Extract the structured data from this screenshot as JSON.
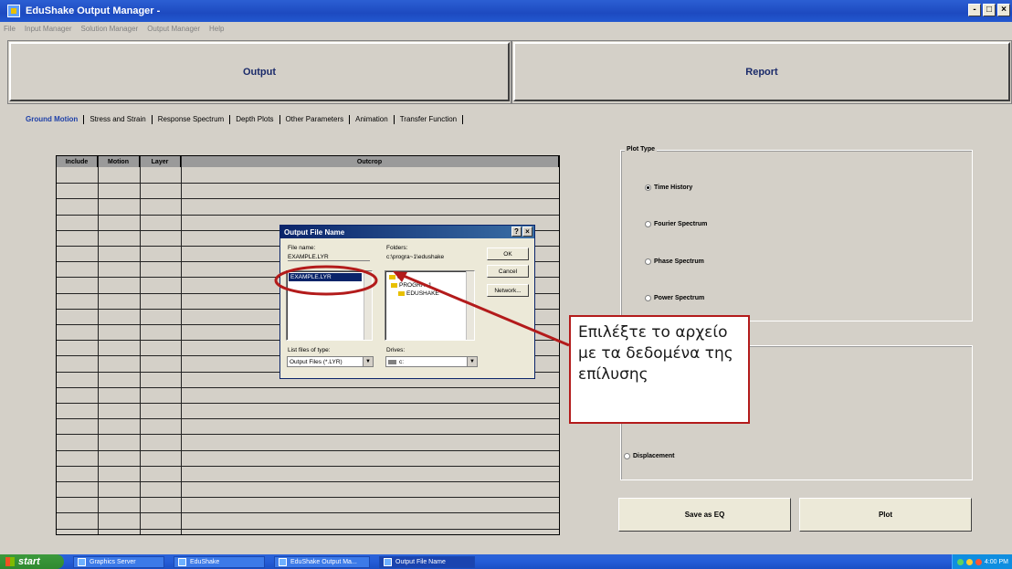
{
  "window": {
    "title": "EduShake Output Manager -"
  },
  "menu": [
    "File",
    "Input Manager",
    "Solution Manager",
    "Output Manager",
    "Help"
  ],
  "big_buttons": {
    "output": "Output",
    "report": "Report"
  },
  "tabs": [
    {
      "label": "Ground Motion",
      "active": true
    },
    {
      "label": "Stress and Strain"
    },
    {
      "label": "Response Spectrum"
    },
    {
      "label": "Depth Plots"
    },
    {
      "label": "Other Parameters"
    },
    {
      "label": "Animation"
    },
    {
      "label": "Transfer Function"
    }
  ],
  "grid": {
    "columns": [
      "Include",
      "Motion",
      "Layer",
      "Outcrop"
    ]
  },
  "plot_type": {
    "label": "Plot Type",
    "options": [
      {
        "label": "Time History",
        "selected": true
      },
      {
        "label": "Fourier Spectrum",
        "selected": false
      },
      {
        "label": "Phase Spectrum",
        "selected": false
      },
      {
        "label": "Power Spectrum",
        "selected": false
      }
    ]
  },
  "group2": {
    "options": [
      {
        "label": "Displacement",
        "selected": false
      }
    ]
  },
  "actions": {
    "save_as_eq": "Save as EQ",
    "plot": "Plot"
  },
  "dialog": {
    "title": "Output File Name",
    "help_btn": "?",
    "close_btn": "×",
    "file_name_label": "File name:",
    "file_name_value": "EXAMPLE.LYR",
    "file_list": [
      "EXAMPLE.LYR"
    ],
    "folders_label": "Folders:",
    "folders_path": "c:\\progra~1\\edushake",
    "folder_tree": [
      "c:\\",
      "PROGRA~1",
      "EDUSHAKE"
    ],
    "ok": "OK",
    "cancel": "Cancel",
    "network": "Network...",
    "list_type_label": "List files of type:",
    "list_type_value": "Output Files (*.LYR)",
    "drives_label": "Drives:",
    "drives_value": "c:"
  },
  "callout": {
    "text": "Επιλέξτε το αρχείο με τα δεδομένα της επίλυσης"
  },
  "taskbar": {
    "start": "start",
    "tasks": [
      "Graphics Server",
      "EduShake",
      "EduShake Output Ma...",
      "Output File Name"
    ],
    "clock": "4:00 PM"
  },
  "colors": {
    "callout_border": "#b31b1b",
    "titlebar": "#245dd7"
  }
}
